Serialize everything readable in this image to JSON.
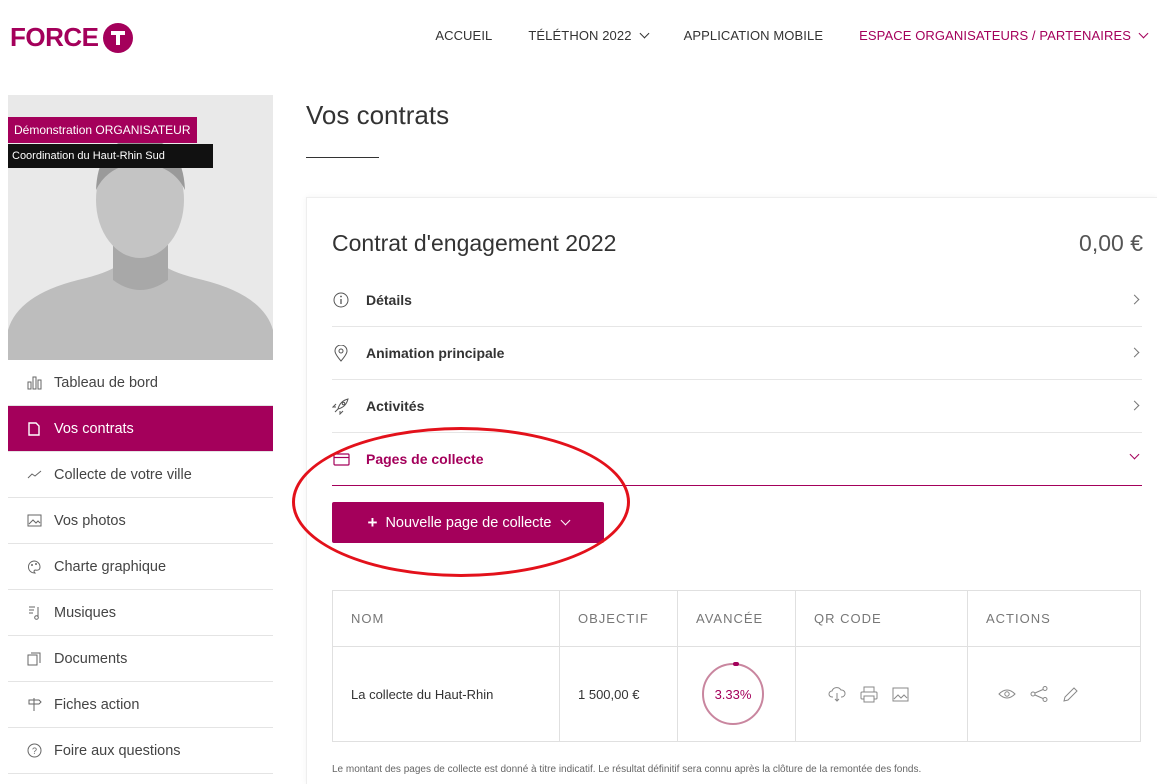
{
  "header": {
    "logo_text": "FORCE",
    "nav": [
      {
        "label": "ACCUEIL",
        "dropdown": false
      },
      {
        "label": "TÉLÉTHON 2022",
        "dropdown": true
      },
      {
        "label": "APPLICATION MOBILE",
        "dropdown": false
      },
      {
        "label": "ESPACE ORGANISATEURS / PARTENAIRES",
        "dropdown": true
      }
    ]
  },
  "profile": {
    "role": "Démonstration ORGANISATEUR",
    "coordination": "Coordination du Haut-Rhin Sud"
  },
  "sidebar": {
    "items": [
      {
        "label": "Tableau de bord",
        "icon": "dashboard-icon"
      },
      {
        "label": "Vos contrats",
        "icon": "document-icon",
        "active": true
      },
      {
        "label": "Collecte de votre ville",
        "icon": "trend-icon"
      },
      {
        "label": "Vos photos",
        "icon": "image-icon"
      },
      {
        "label": "Charte graphique",
        "icon": "palette-icon"
      },
      {
        "label": "Musiques",
        "icon": "music-icon"
      },
      {
        "label": "Documents",
        "icon": "documents-icon"
      },
      {
        "label": "Fiches action",
        "icon": "signpost-icon"
      },
      {
        "label": "Foire aux questions",
        "icon": "question-icon"
      }
    ]
  },
  "main": {
    "title": "Vos contrats",
    "contract": {
      "title": "Contrat d'engagement 2022",
      "amount": "0,00 €",
      "sections": [
        {
          "label": "Détails",
          "icon": "info-icon"
        },
        {
          "label": "Animation principale",
          "icon": "location-pin-icon"
        },
        {
          "label": "Activités",
          "icon": "rocket-icon"
        },
        {
          "label": "Pages de collecte",
          "icon": "card-icon",
          "open": true
        }
      ],
      "new_page_button": "Nouvelle page de collecte"
    },
    "table": {
      "headers": [
        "NOM",
        "OBJECTIF",
        "AVANCÉE",
        "QR CODE",
        "ACTIONS"
      ],
      "rows": [
        {
          "name": "La collecte du Haut-Rhin",
          "objective": "1 500,00 €",
          "progress_label": "3.33%",
          "progress": 0.0333
        }
      ]
    },
    "footnote": "Le montant des pages de collecte est donné à titre indicatif. Le résultat définitif sera connu après la clôture de la remontée des fonds."
  },
  "colors": {
    "brand": "#a4005b",
    "annotation": "#e3111b"
  }
}
